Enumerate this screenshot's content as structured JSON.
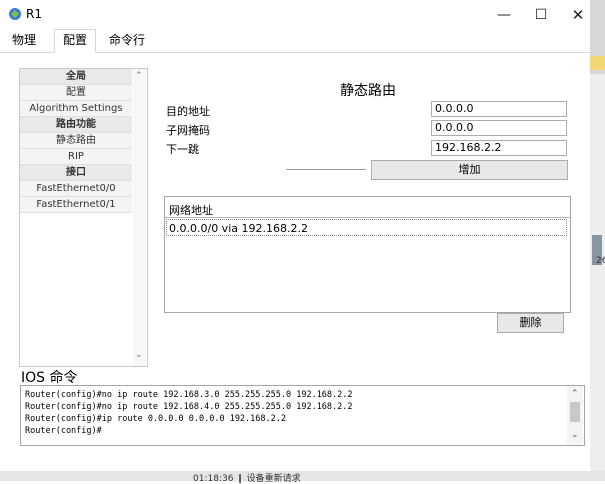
{
  "window": {
    "title": "R1",
    "minimize_glyph": "—",
    "maximize_glyph": "☐",
    "close_glyph": "✕"
  },
  "tabs": [
    {
      "label": "物理"
    },
    {
      "label": "配置",
      "active": true
    },
    {
      "label": "命令行"
    }
  ],
  "sidebar": {
    "items": [
      {
        "label": "全局",
        "header": true
      },
      {
        "label": "配置",
        "header": false
      },
      {
        "label": "Algorithm Settings",
        "header": false
      },
      {
        "label": "路由功能",
        "header": true
      },
      {
        "label": "静态路由",
        "header": false
      },
      {
        "label": "RIP",
        "header": false
      },
      {
        "label": "接口",
        "header": true
      },
      {
        "label": "FastEthernet0/0",
        "header": false
      },
      {
        "label": "FastEthernet0/1",
        "header": false
      }
    ]
  },
  "static_route": {
    "title": "静态路由",
    "dest_label": "目的地址",
    "dest_value": "0.0.0.0",
    "mask_label": "子网掩码",
    "mask_value": "0.0.0.0",
    "nexthop_label": "下一跳",
    "nexthop_value": "192.168.2.2",
    "add_button": "增加",
    "list_header": "网络地址",
    "routes": [
      "0.0.0.0/0 via 192.168.2.2"
    ],
    "delete_button": "删除"
  },
  "ios": {
    "label": "IOS 命令",
    "lines": [
      "Router(config)#no ip route 192.168.3.0 255.255.255.0 192.168.2.2",
      "Router(config)#no ip route 192.168.4.0 255.255.255.0 192.168.2.2",
      "Router(config)#ip route 0.0.0.0 0.0.0.0 192.168.2.2",
      "Router(config)#"
    ]
  },
  "background": {
    "edge_text": "26",
    "bottom_text": "01:18:36 ❙ 设备重新请求"
  },
  "colors": {
    "accent": "#f2d873",
    "header_bg": "#e9e9e9",
    "item_bg": "#f4f4f4",
    "button_bg": "#e8e8e8"
  }
}
